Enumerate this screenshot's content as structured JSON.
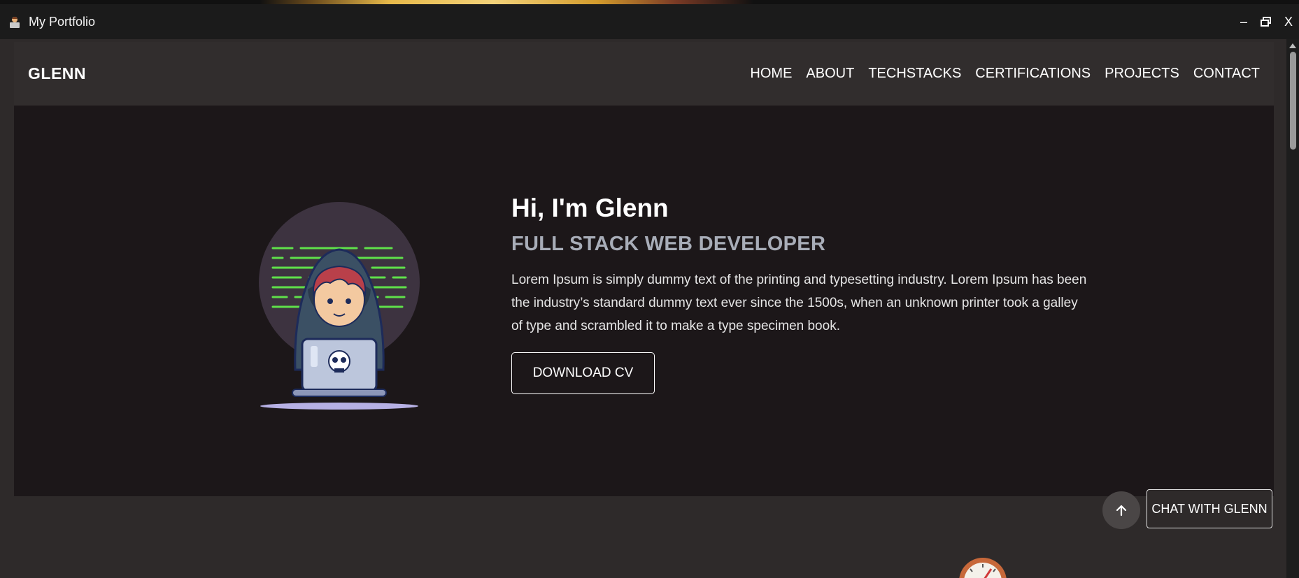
{
  "window": {
    "title": "My Portfolio",
    "minimize": "–",
    "restore": "🗗",
    "close": "X"
  },
  "navbar": {
    "brand": "GLENN",
    "links": [
      "HOME",
      "ABOUT",
      "TECHSTACKS",
      "CERTIFICATIONS",
      "PROJECTS",
      "CONTACT"
    ]
  },
  "hero": {
    "greeting": "Hi, I'm Glenn",
    "role": "FULL STACK WEB DEVELOPER",
    "bio": "Lorem Ipsum is simply dummy text of the printing and typesetting industry. Lorem Ipsum has been the industry’s standard dummy text ever since the 1500s, when an unknown printer took a galley of type and scrambled it to make a type specimen book.",
    "cta_label": "DOWNLOAD CV",
    "illustration_icon": "hacker-laptop-icon"
  },
  "floating": {
    "chat_label": "CHAT WITH GLENN",
    "scroll_top_icon": "arrow-up-icon"
  },
  "colors": {
    "page_bg": "#2e2a2a",
    "hero_bg": "#1c1719",
    "role_text": "#a8adb8",
    "accent_green": "#5fe04a"
  }
}
